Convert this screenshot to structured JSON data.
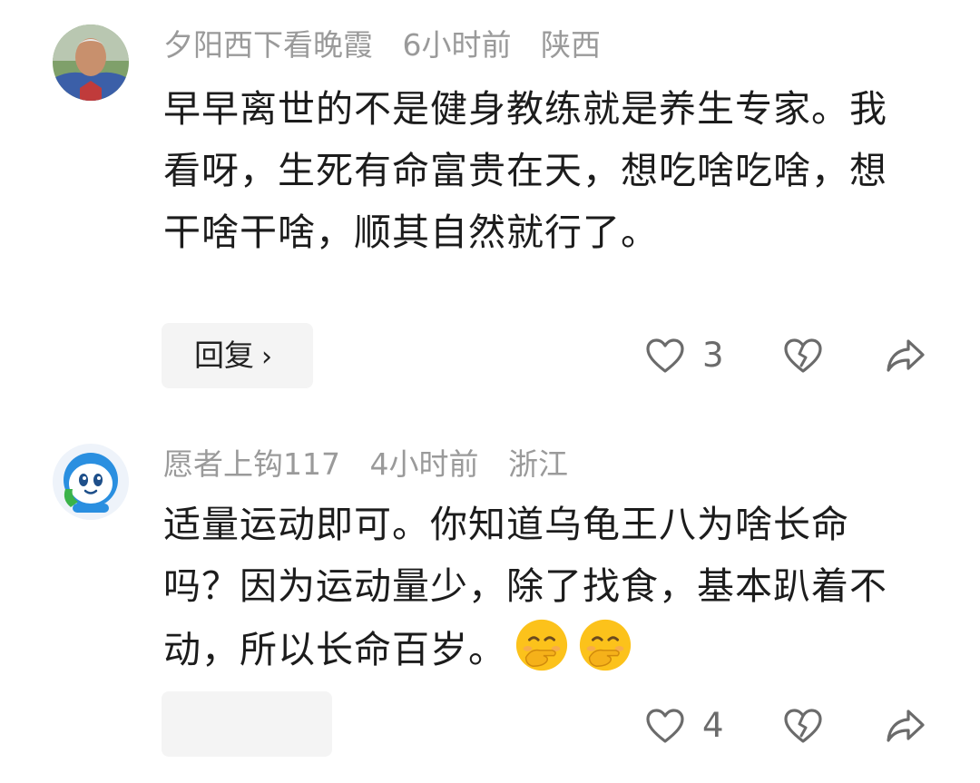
{
  "comments": [
    {
      "username": "夕阳西下看晚霞",
      "time": "6小时前",
      "region": "陕西",
      "text": "早早离世的不是健身教练就是养生专家。我看呀，生死有命富贵在天，想吃啥吃啥，想干啥干啥，顺其自然就行了。",
      "reply_label": "回复",
      "reply_chevron": "›",
      "like_count": "3"
    },
    {
      "username": "愿者上钩117",
      "time": "4小时前",
      "region": "浙江",
      "text": "适量运动即可。你知道乌龟王八为啥长命吗？因为运动量少，除了找食，基本趴着不动，所以长命百岁。",
      "emojis": [
        "hand-over-mouth-emoji",
        "hand-over-mouth-emoji"
      ],
      "like_count": "4"
    }
  ],
  "icons": {
    "like": "heart-outline-icon",
    "dislike": "broken-heart-icon",
    "share": "share-arrow-icon"
  },
  "colors": {
    "meta_text": "#9a9a9a",
    "body_text": "#1c1c1c",
    "reply_bg": "#f4f4f4",
    "icon_gray": "#6b6b6b"
  }
}
